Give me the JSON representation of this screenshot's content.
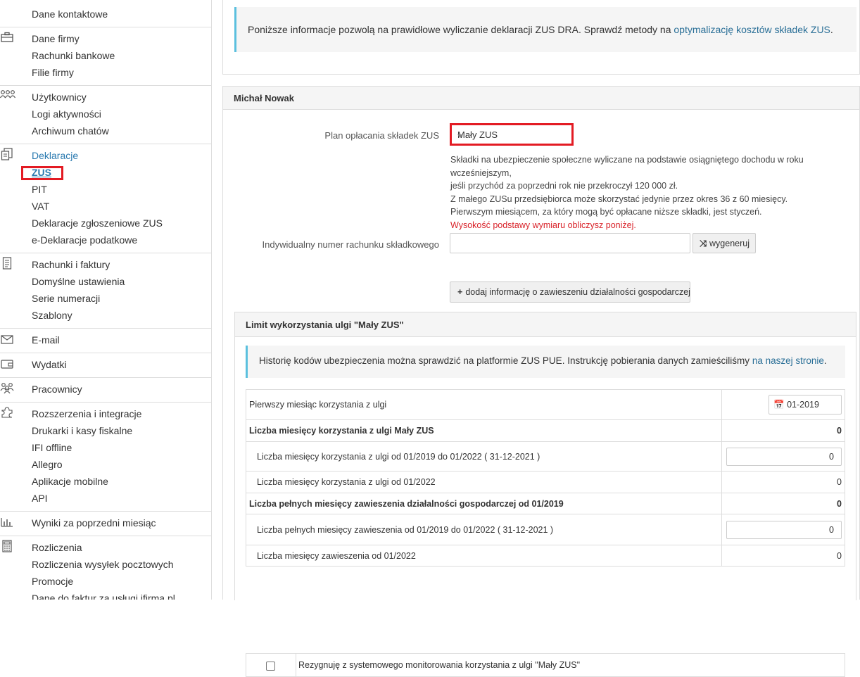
{
  "sidebar": {
    "groups": [
      {
        "icon": "",
        "items": [
          "Dane kontaktowe"
        ]
      },
      {
        "icon": "briefcase-icon",
        "items": [
          "Dane firmy",
          "Rachunki bankowe",
          "Filie firmy"
        ]
      },
      {
        "icon": "users-icon",
        "items": [
          "Użytkownicy",
          "Logi aktywności",
          "Archiwum chatów"
        ]
      },
      {
        "icon": "declarations-icon",
        "items": [
          "Deklaracje",
          "ZUS",
          "PIT",
          "VAT",
          "Deklaracje zgłoszeniowe ZUS",
          "e-Deklaracje podatkowe"
        ]
      },
      {
        "icon": "invoice-icon",
        "items": [
          "Rachunki i faktury",
          "Domyślne ustawienia",
          "Serie numeracji",
          "Szablony"
        ]
      },
      {
        "icon": "envelope-icon",
        "items": [
          "E-mail"
        ]
      },
      {
        "icon": "wallet-icon",
        "items": [
          "Wydatki"
        ]
      },
      {
        "icon": "employees-icon",
        "items": [
          "Pracownicy"
        ]
      },
      {
        "icon": "puzzle-icon",
        "items": [
          "Rozszerzenia i integracje",
          "Drukarki i kasy fiskalne",
          "IFI offline",
          "Allegro",
          "Aplikacje mobilne",
          "API"
        ]
      },
      {
        "icon": "bar-chart-icon",
        "items": [
          "Wyniki za poprzedni miesiąc"
        ]
      },
      {
        "icon": "calculator-icon",
        "items": [
          "Rozliczenia",
          "Rozliczenia wysyłek pocztowych",
          "Promocje",
          "Dane do faktur za usługi ifirma.pl"
        ]
      }
    ]
  },
  "top_info": {
    "text": "Poniższe informacje pozwolą na prawidłowe wyliczanie deklaracji ZUS DRA. Sprawdź metody na ",
    "link": "optymalizację kosztów składek ZUS",
    "end": "."
  },
  "person": {
    "name": "Michał Nowak",
    "plan_label": "Plan opłacania składek ZUS",
    "plan_value": "Mały ZUS",
    "description": [
      "Składki na ubezpieczenie społeczne wyliczane na podstawie osiągniętego dochodu w roku wcześniejszym,",
      "jeśli przychód za poprzedni rok nie przekroczył 120 000 zł.",
      "Z małego ZUSu przedsiębiorca może skorzystać jedynie przez okres 36 z 60 miesięcy.",
      "Pierwszym miesiącem, za który mogą być opłacane niższe składki, jest styczeń."
    ],
    "description_red": "Wysokość podstawy wymiaru obliczysz poniżej.",
    "account_label": "Indywidualny numer rachunku składkowego",
    "account_value": "",
    "generate_label": "wygeneruj",
    "add_suspension_label": "dodaj informację o zawieszeniu działalności gospodarczej"
  },
  "limit": {
    "title": "Limit wykorzystania ulgi \"Mały ZUS\"",
    "info_text": "Historię kodów ubezpieczenia można sprawdzić na platformie ZUS PUE. Instrukcję pobierania danych zamieściliśmy ",
    "info_link": "na naszej stronie",
    "info_end": ".",
    "rows": [
      {
        "label": "Pierwszy miesiąc korzystania z ulgi",
        "value": "01-2019"
      },
      {
        "label": "Liczba miesięcy korzystania z ulgi Mały ZUS",
        "value": "0"
      },
      {
        "label": "Liczba miesięcy korzystania z ulgi od 01/2019 do 01/2022 ( 31-12-2021 )",
        "value": "0"
      },
      {
        "label": "Liczba miesięcy korzystania z ulgi od 01/2022",
        "value": "0"
      },
      {
        "label": "Liczba pełnych miesięcy zawieszenia działalności gospodarczej od 01/2019",
        "value": "0"
      },
      {
        "label": "Liczba pełnych miesięcy zawieszenia od 01/2019 do 01/2022 ( 31-12-2021 )",
        "value": "0"
      },
      {
        "label": "Liczba miesięcy zawieszenia od 01/2022",
        "value": "0"
      }
    ],
    "checkbox_label": "Rezygnuję z systemowego monitorowania korzystania z ulgi \"Mały ZUS\""
  }
}
